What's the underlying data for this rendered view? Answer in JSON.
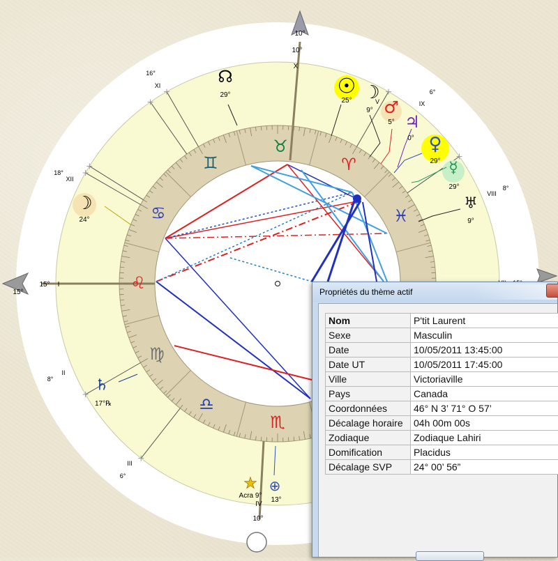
{
  "colors": {
    "ring_fill": "#fafad2",
    "zodiac_ring": "#ddd3b3",
    "red": "#e02020",
    "blue": "#2040d0",
    "lightblue": "#40a0e0",
    "green": "#20a060",
    "sun_highlight": "#ffff00"
  },
  "axes": {
    "asc_label": "15°",
    "asc_label_small": "15°",
    "asc_roman": "I",
    "mc_label": "10°",
    "mc_roman": "X",
    "mc_top": "10°",
    "ic_label": "10°",
    "ic_roman": "IV"
  },
  "house_labels": [
    {
      "roman": "XI",
      "deg": "16°"
    },
    {
      "roman": "XII",
      "deg": "18°"
    },
    {
      "roman": "II",
      "deg": "8°"
    },
    {
      "roman": "III",
      "deg": "6°"
    },
    {
      "roman": "IX",
      "deg": "6°"
    },
    {
      "roman": "VIII",
      "deg": "8°"
    },
    {
      "roman": "V",
      "deg": ""
    },
    {
      "roman": "VII",
      "deg": "15°"
    }
  ],
  "signs": [
    {
      "name": "taurus",
      "glyph": "♉",
      "color": "#108040"
    },
    {
      "name": "gemini",
      "glyph": "♊",
      "color": "#1a6070"
    },
    {
      "name": "aries",
      "glyph": "♈",
      "color": "#e02020"
    },
    {
      "name": "cancer",
      "glyph": "♋",
      "color": "#3040b0"
    },
    {
      "name": "pisces",
      "glyph": "♓",
      "color": "#3040b0"
    },
    {
      "name": "leo",
      "glyph": "♌",
      "color": "#e02020"
    },
    {
      "name": "virgo",
      "glyph": "♍",
      "color": "#707070"
    },
    {
      "name": "libra",
      "glyph": "♎",
      "color": "#2040c0"
    },
    {
      "name": "scorpio",
      "glyph": "♏",
      "color": "#e02020"
    }
  ],
  "planets": [
    {
      "name": "north-node",
      "glyph": "☊",
      "deg": "29°",
      "color": "#000000"
    },
    {
      "name": "sun",
      "glyph": "☉",
      "deg": "25°",
      "color": "#000000"
    },
    {
      "name": "moon-conj",
      "glyph": "☽",
      "deg": "9°",
      "color": "#000000"
    },
    {
      "name": "mars",
      "glyph": "♂",
      "deg": "5°",
      "color": "#e02020"
    },
    {
      "name": "jupiter",
      "glyph": "♃",
      "deg": "0°",
      "color": "#7020c0"
    },
    {
      "name": "venus",
      "glyph": "♀",
      "deg": "29°",
      "color": "#3050c0"
    },
    {
      "name": "mercury",
      "glyph": "☿",
      "deg": "29°",
      "color": "#209050"
    },
    {
      "name": "uranus",
      "glyph": "♅",
      "deg": "9°",
      "color": "#000000"
    },
    {
      "name": "moon",
      "glyph": "☽",
      "deg": "24°",
      "color": "#000000"
    },
    {
      "name": "saturn",
      "glyph": "♄",
      "deg": "17°℞",
      "color": "#1a40a0"
    },
    {
      "name": "acra",
      "glyph": "★",
      "deg": "Acra 9°",
      "color": "#d8b000"
    },
    {
      "name": "earth",
      "glyph": "⊕",
      "deg": "13°",
      "color": "#3050c0"
    }
  ],
  "dialog": {
    "title": "Propriétés du thème actif",
    "rows": [
      {
        "k": "Nom",
        "v": "P'tit Laurent"
      },
      {
        "k": "Sexe",
        "v": "Masculin"
      },
      {
        "k": "Date",
        "v": "10/05/2011 13:45:00"
      },
      {
        "k": "Date UT",
        "v": "10/05/2011 17:45:00"
      },
      {
        "k": "Ville",
        "v": "Victoriaville"
      },
      {
        "k": "Pays",
        "v": "Canada"
      },
      {
        "k": "Coordonnées",
        "v": "46° N 3’ 71° O 57’"
      },
      {
        "k": "Décalage horaire",
        "v": "04h 00m 00s"
      },
      {
        "k": "Zodiaque",
        "v": "Zodiaque Lahiri"
      },
      {
        "k": "Domification",
        "v": "Placidus"
      },
      {
        "k": "Décalage SVP",
        "v": "24° 00’ 56”"
      }
    ]
  }
}
